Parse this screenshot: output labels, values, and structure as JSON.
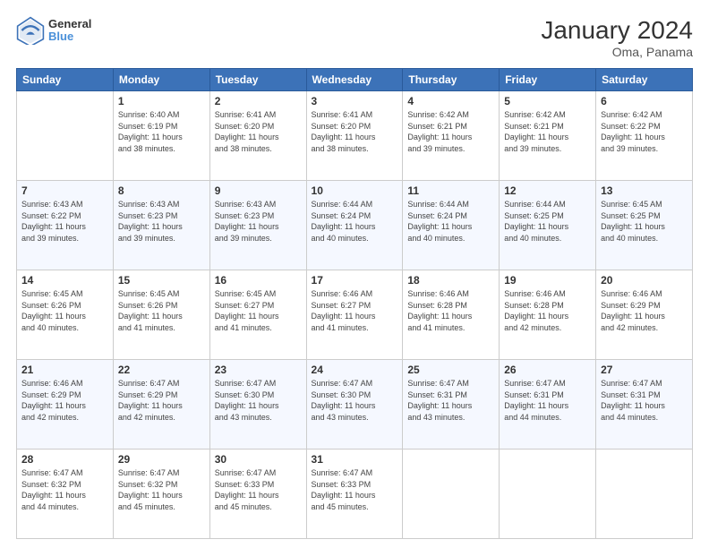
{
  "header": {
    "logo_line1": "General",
    "logo_line2": "Blue",
    "title": "January 2024",
    "subtitle": "Oma, Panama"
  },
  "days_of_week": [
    "Sunday",
    "Monday",
    "Tuesday",
    "Wednesday",
    "Thursday",
    "Friday",
    "Saturday"
  ],
  "weeks": [
    [
      {
        "day": "",
        "info": ""
      },
      {
        "day": "1",
        "info": "Sunrise: 6:40 AM\nSunset: 6:19 PM\nDaylight: 11 hours\nand 38 minutes."
      },
      {
        "day": "2",
        "info": "Sunrise: 6:41 AM\nSunset: 6:20 PM\nDaylight: 11 hours\nand 38 minutes."
      },
      {
        "day": "3",
        "info": "Sunrise: 6:41 AM\nSunset: 6:20 PM\nDaylight: 11 hours\nand 38 minutes."
      },
      {
        "day": "4",
        "info": "Sunrise: 6:42 AM\nSunset: 6:21 PM\nDaylight: 11 hours\nand 39 minutes."
      },
      {
        "day": "5",
        "info": "Sunrise: 6:42 AM\nSunset: 6:21 PM\nDaylight: 11 hours\nand 39 minutes."
      },
      {
        "day": "6",
        "info": "Sunrise: 6:42 AM\nSunset: 6:22 PM\nDaylight: 11 hours\nand 39 minutes."
      }
    ],
    [
      {
        "day": "7",
        "info": "Sunrise: 6:43 AM\nSunset: 6:22 PM\nDaylight: 11 hours\nand 39 minutes."
      },
      {
        "day": "8",
        "info": "Sunrise: 6:43 AM\nSunset: 6:23 PM\nDaylight: 11 hours\nand 39 minutes."
      },
      {
        "day": "9",
        "info": "Sunrise: 6:43 AM\nSunset: 6:23 PM\nDaylight: 11 hours\nand 39 minutes."
      },
      {
        "day": "10",
        "info": "Sunrise: 6:44 AM\nSunset: 6:24 PM\nDaylight: 11 hours\nand 40 minutes."
      },
      {
        "day": "11",
        "info": "Sunrise: 6:44 AM\nSunset: 6:24 PM\nDaylight: 11 hours\nand 40 minutes."
      },
      {
        "day": "12",
        "info": "Sunrise: 6:44 AM\nSunset: 6:25 PM\nDaylight: 11 hours\nand 40 minutes."
      },
      {
        "day": "13",
        "info": "Sunrise: 6:45 AM\nSunset: 6:25 PM\nDaylight: 11 hours\nand 40 minutes."
      }
    ],
    [
      {
        "day": "14",
        "info": "Sunrise: 6:45 AM\nSunset: 6:26 PM\nDaylight: 11 hours\nand 40 minutes."
      },
      {
        "day": "15",
        "info": "Sunrise: 6:45 AM\nSunset: 6:26 PM\nDaylight: 11 hours\nand 41 minutes."
      },
      {
        "day": "16",
        "info": "Sunrise: 6:45 AM\nSunset: 6:27 PM\nDaylight: 11 hours\nand 41 minutes."
      },
      {
        "day": "17",
        "info": "Sunrise: 6:46 AM\nSunset: 6:27 PM\nDaylight: 11 hours\nand 41 minutes."
      },
      {
        "day": "18",
        "info": "Sunrise: 6:46 AM\nSunset: 6:28 PM\nDaylight: 11 hours\nand 41 minutes."
      },
      {
        "day": "19",
        "info": "Sunrise: 6:46 AM\nSunset: 6:28 PM\nDaylight: 11 hours\nand 42 minutes."
      },
      {
        "day": "20",
        "info": "Sunrise: 6:46 AM\nSunset: 6:29 PM\nDaylight: 11 hours\nand 42 minutes."
      }
    ],
    [
      {
        "day": "21",
        "info": "Sunrise: 6:46 AM\nSunset: 6:29 PM\nDaylight: 11 hours\nand 42 minutes."
      },
      {
        "day": "22",
        "info": "Sunrise: 6:47 AM\nSunset: 6:29 PM\nDaylight: 11 hours\nand 42 minutes."
      },
      {
        "day": "23",
        "info": "Sunrise: 6:47 AM\nSunset: 6:30 PM\nDaylight: 11 hours\nand 43 minutes."
      },
      {
        "day": "24",
        "info": "Sunrise: 6:47 AM\nSunset: 6:30 PM\nDaylight: 11 hours\nand 43 minutes."
      },
      {
        "day": "25",
        "info": "Sunrise: 6:47 AM\nSunset: 6:31 PM\nDaylight: 11 hours\nand 43 minutes."
      },
      {
        "day": "26",
        "info": "Sunrise: 6:47 AM\nSunset: 6:31 PM\nDaylight: 11 hours\nand 44 minutes."
      },
      {
        "day": "27",
        "info": "Sunrise: 6:47 AM\nSunset: 6:31 PM\nDaylight: 11 hours\nand 44 minutes."
      }
    ],
    [
      {
        "day": "28",
        "info": "Sunrise: 6:47 AM\nSunset: 6:32 PM\nDaylight: 11 hours\nand 44 minutes."
      },
      {
        "day": "29",
        "info": "Sunrise: 6:47 AM\nSunset: 6:32 PM\nDaylight: 11 hours\nand 45 minutes."
      },
      {
        "day": "30",
        "info": "Sunrise: 6:47 AM\nSunset: 6:33 PM\nDaylight: 11 hours\nand 45 minutes."
      },
      {
        "day": "31",
        "info": "Sunrise: 6:47 AM\nSunset: 6:33 PM\nDaylight: 11 hours\nand 45 minutes."
      },
      {
        "day": "",
        "info": ""
      },
      {
        "day": "",
        "info": ""
      },
      {
        "day": "",
        "info": ""
      }
    ]
  ]
}
